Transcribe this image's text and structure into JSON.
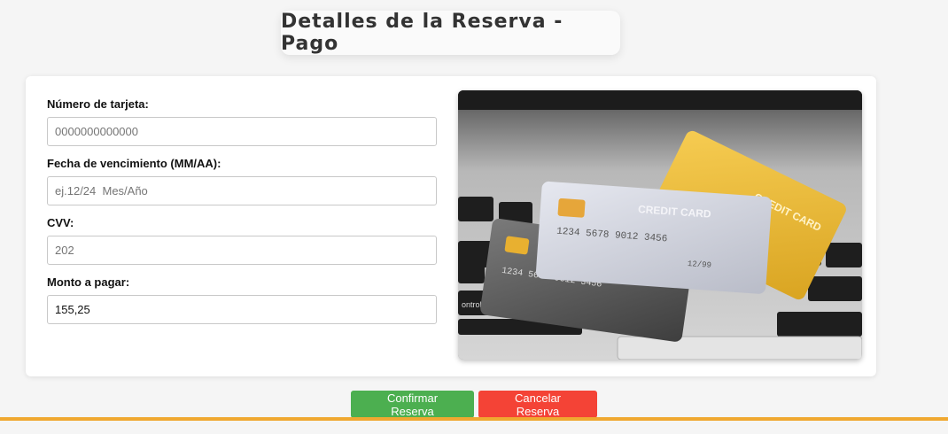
{
  "page": {
    "title": "Detalles de la Reserva - Pago"
  },
  "form": {
    "card_number": {
      "label": "Número de tarjeta:",
      "value": "",
      "placeholder": "0000000000000"
    },
    "expiry": {
      "label": "Fecha de vencimiento (MM/AA):",
      "value": "",
      "placeholder": "ej.12/24  Mes/Año"
    },
    "cvv": {
      "label": "CVV:",
      "value": "",
      "placeholder": "202"
    },
    "amount": {
      "label": "Monto a pagar:",
      "value": "155,25",
      "placeholder": ""
    }
  },
  "image": {
    "card_texts": [
      "CREDIT CARD",
      "CREDIT CARD",
      "option",
      "control",
      "ontrol"
    ]
  },
  "actions": {
    "confirm_label": "Confirmar Reserva",
    "cancel_label": "Cancelar Reserva"
  },
  "colors": {
    "confirm": "#4caf50",
    "cancel": "#f44336",
    "accent_line": "#f0a830"
  }
}
